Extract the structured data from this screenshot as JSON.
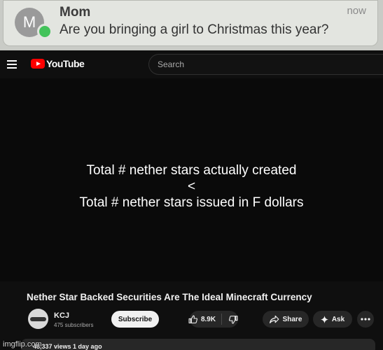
{
  "notification": {
    "avatar_letter": "M",
    "sender": "Mom",
    "time": "now",
    "message": "Are you bringing a girl to Christmas this year?"
  },
  "header": {
    "logo_text": "YouTube",
    "search_placeholder": "Search"
  },
  "video": {
    "slide_lines": [
      "Total # nether stars actually created",
      "<",
      "Total # nether stars issued in F dollars"
    ],
    "title": "Nether Star Backed Securities Are The Ideal Minecraft Currency"
  },
  "channel": {
    "name": "KCJ",
    "subscribers": "475 subscribers",
    "subscribe_label": "Subscribe"
  },
  "actions": {
    "likes": "8.9K",
    "share_label": "Share",
    "ask_label": "Ask"
  },
  "description": {
    "views_age": "48,337 views  1 day ago"
  },
  "watermark": "imgflip.com",
  "colors": {
    "background": "#0f0f0f",
    "brand_red": "#ff0000",
    "notification_badge": "#43c35a"
  }
}
